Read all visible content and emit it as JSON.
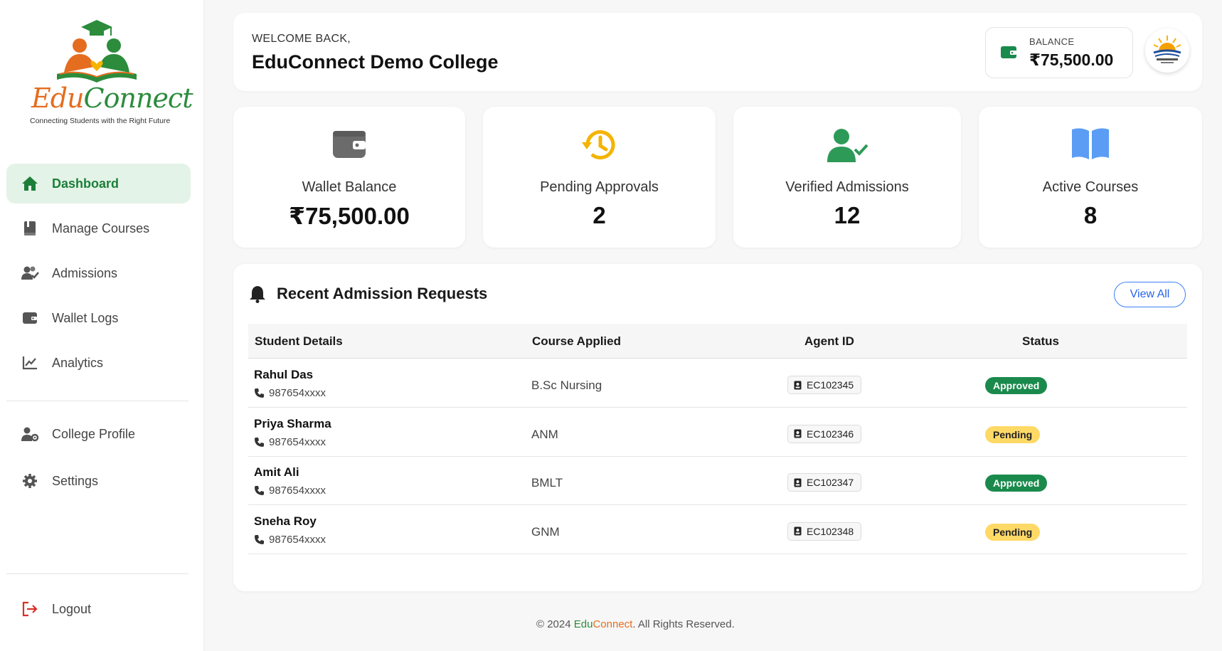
{
  "brand": {
    "logo_edu": "Edu",
    "logo_connect": "Connect",
    "tagline": "Connecting Students with the Right Future"
  },
  "sidebar": {
    "items": [
      {
        "label": "Dashboard",
        "icon": "home-icon",
        "active": true
      },
      {
        "label": "Manage Courses",
        "icon": "book-icon"
      },
      {
        "label": "Admissions",
        "icon": "users-check-icon"
      },
      {
        "label": "Wallet Logs",
        "icon": "wallet-icon"
      },
      {
        "label": "Analytics",
        "icon": "chart-line-icon"
      }
    ],
    "secondary": [
      {
        "label": "College Profile",
        "icon": "user-gear-icon"
      },
      {
        "label": "Settings",
        "icon": "gear-icon"
      }
    ],
    "logout": {
      "label": "Logout",
      "icon": "logout-icon"
    }
  },
  "header": {
    "welcome": "WELCOME BACK,",
    "college_name": "EduConnect Demo College",
    "balance_label": "BALANCE",
    "balance_value": "₹75,500.00"
  },
  "stats": [
    {
      "label": "Wallet Balance",
      "value": "₹75,500.00",
      "icon": "wallet-icon"
    },
    {
      "label": "Pending Approvals",
      "value": "2",
      "icon": "history-icon"
    },
    {
      "label": "Verified Admissions",
      "value": "12",
      "icon": "user-check-icon"
    },
    {
      "label": "Active Courses",
      "value": "8",
      "icon": "open-book-icon"
    }
  ],
  "requests": {
    "title": "Recent Admission Requests",
    "view_all": "View All",
    "columns": [
      "Student Details",
      "Course Applied",
      "Agent ID",
      "Status"
    ],
    "rows": [
      {
        "name": "Rahul Das",
        "phone": "987654xxxx",
        "course": "B.Sc Nursing",
        "agent": "EC102345",
        "status": "Approved"
      },
      {
        "name": "Priya Sharma",
        "phone": "987654xxxx",
        "course": "ANM",
        "agent": "EC102346",
        "status": "Pending"
      },
      {
        "name": "Amit Ali",
        "phone": "987654xxxx",
        "course": "BMLT",
        "agent": "EC102347",
        "status": "Approved"
      },
      {
        "name": "Sneha Roy",
        "phone": "987654xxxx",
        "course": "GNM",
        "agent": "EC102348",
        "status": "Pending"
      }
    ]
  },
  "footer": {
    "prefix": "© 2024 ",
    "edu": "Edu",
    "connect": "Connect",
    "suffix": ". All Rights Reserved."
  },
  "colors": {
    "brand_green": "#2c8c3c",
    "brand_orange": "#e56d1f",
    "approved": "#1a8a4c",
    "pending": "#ffd966",
    "link_blue": "#2563eb"
  }
}
